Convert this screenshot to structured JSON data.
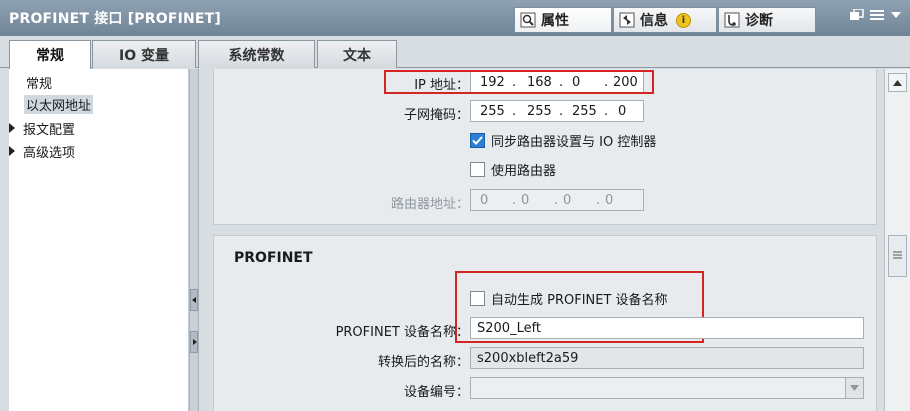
{
  "window": {
    "title": "PROFINET 接口 [PROFINET]"
  },
  "inspector_tabs": [
    {
      "label": "属性",
      "icon": "properties-icon"
    },
    {
      "label": "信息",
      "icon": "info-icon",
      "badge": "i"
    },
    {
      "label": "诊断",
      "icon": "diagnostics-icon"
    }
  ],
  "main_tabs": [
    {
      "label": "常规"
    },
    {
      "label": "IO 变量"
    },
    {
      "label": "系统常数"
    },
    {
      "label": "文本"
    }
  ],
  "nav": [
    {
      "label": "常规"
    },
    {
      "label": "以太网地址"
    },
    {
      "label": "报文配置"
    },
    {
      "label": "高级选项"
    }
  ],
  "ethernet": {
    "ip_label": "IP 地址：",
    "ip": [
      "192",
      ".",
      "168",
      ".",
      "0",
      ".",
      "200"
    ],
    "mask_label": "子网掩码：",
    "mask": [
      "255",
      ".",
      "255",
      ".",
      "255",
      ".",
      "0"
    ],
    "sync_router_label": "同步路由器设置与 IO 控制器",
    "use_router_label": "使用路由器",
    "router_label": "路由器地址：",
    "router": [
      "0",
      ".",
      "0",
      ".",
      "0",
      ".",
      "0"
    ]
  },
  "profinet": {
    "heading": "PROFINET",
    "auto_name_label": "自动生成 PROFINET 设备名称",
    "device_name_label": "PROFINET 设备名称：",
    "device_name": "S200_Left",
    "converted_name_label": "转换后的名称：",
    "converted_name": "s200xbleft2a59",
    "device_number_label": "设备编号："
  },
  "colors": {
    "highlight": "#d42424",
    "checkbox": "#2c7fd4",
    "titlebar": "#6f8496"
  }
}
